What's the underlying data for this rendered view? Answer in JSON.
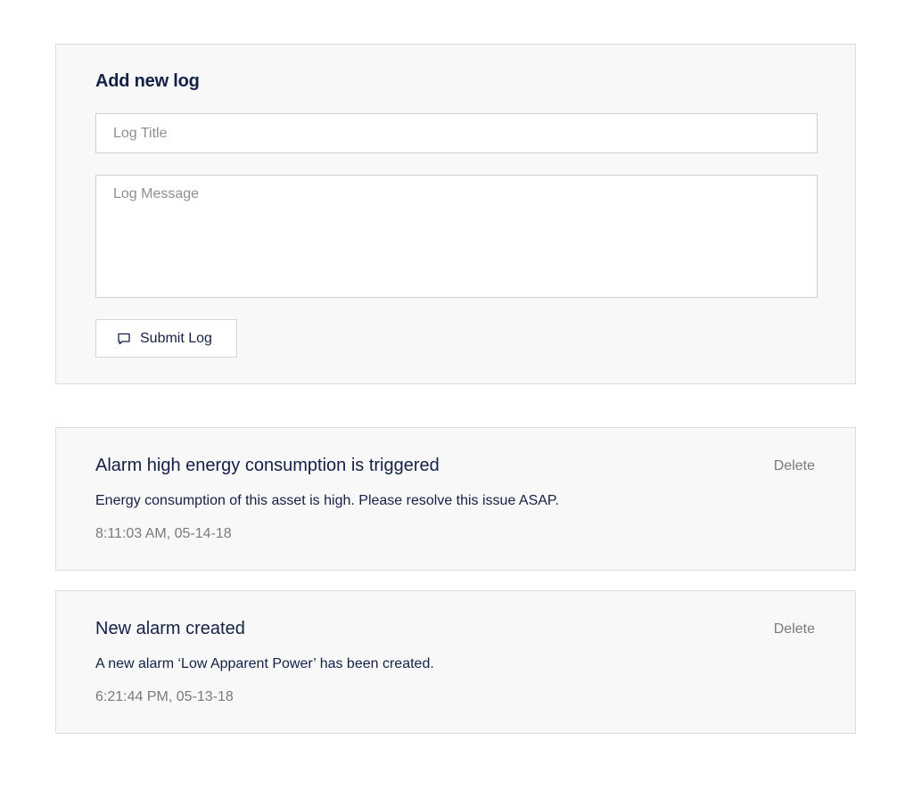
{
  "form": {
    "title": "Add new log",
    "title_placeholder": "Log Title",
    "message_placeholder": "Log Message",
    "submit_label": "Submit Log",
    "submit_icon": "comment-icon"
  },
  "logs": [
    {
      "title": "Alarm high energy consumption is triggered",
      "message": "Energy consumption of this asset is high. Please resolve this issue ASAP.",
      "timestamp": "8:11:03 AM, 05-14-18",
      "delete_label": "Delete"
    },
    {
      "title": "New alarm created",
      "message": "A new alarm ‘Low Apparent Power’ has been created.",
      "timestamp": "6:21:44 PM, 05-13-18",
      "delete_label": "Delete"
    }
  ],
  "colors": {
    "primary_text": "#142046",
    "muted_text": "#7a7a7a",
    "placeholder": "#8f8f8f",
    "panel_bg": "#f8f8f8",
    "border": "#dcdcdc"
  }
}
